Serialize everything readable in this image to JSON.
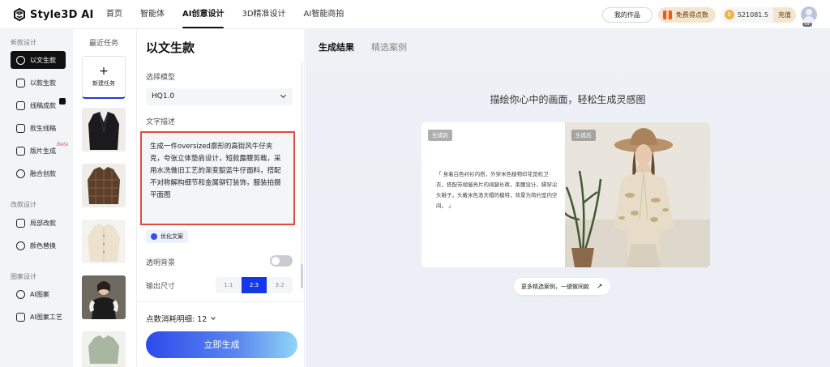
{
  "app": {
    "logo_text": "Style3D AI"
  },
  "nav": [
    "首页",
    "智能体",
    "AI创意设计",
    "3D精准设计",
    "AI智能商拍"
  ],
  "topbar": {
    "my_works": "我的作品",
    "free_points": "免费得点数",
    "credits": "521081.5",
    "recharge": "充值",
    "vip": "VIP"
  },
  "sidebar": {
    "sections": [
      {
        "label": "新款设计",
        "items": [
          "以文生款",
          "以款生款",
          "线稿成款",
          "款生线稿",
          "版片生成",
          "融合创款"
        ]
      },
      {
        "label": "改款设计",
        "items": [
          "局部改款",
          "颜色替换"
        ]
      },
      {
        "label": "图案设计",
        "items": [
          "AI图案",
          "AI图案工艺"
        ]
      }
    ],
    "beta": "Beta"
  },
  "recent": {
    "title": "最近任务",
    "new_task_plus": "+",
    "new_task": "新建任务"
  },
  "form": {
    "title": "以文生款",
    "model_label": "选择模型",
    "model_value": "HQ1.0",
    "text_label": "文字描述",
    "text_value": "生成一件oversized廓形的高街风牛仔夹克，夸张立体垫肩设计，短款露腰剪裁，采用水洗做旧工艺的渐变靛蓝牛仔面料，搭配不对称解构细节和金属铆钉装饰，服装拍摄平面图",
    "optimize": "优化文案",
    "transparent_label": "透明背景",
    "transparent_on": false,
    "size_label": "输出尺寸",
    "ratios": [
      "1:1",
      "2:3",
      "3:2"
    ],
    "ratio_selected": "2:3",
    "points_label": "点数消耗明细: 12",
    "generate": "立即生成"
  },
  "main": {
    "tabs": [
      "生成结果",
      "精选案例"
    ],
    "headline": "描绘你心中的画面，轻松生成灵感图",
    "before_tag": "生成前",
    "after_tag": "生成后",
    "example_prompt": "「 身着白色衬衫内搭，外穿米色植物印花宽松卫衣，搭配带褶皱亮片的阔腿长裤，束腰设计，脚穿尖头鞋子，头戴米色渔夫帽的模特，背景为简约室内空间。 」",
    "more_cases": "更多精选案例，一键做同款",
    "more_arrow": "↗"
  },
  "colors": {
    "accent": "#1438e8",
    "highlight_border": "#e24a40"
  }
}
